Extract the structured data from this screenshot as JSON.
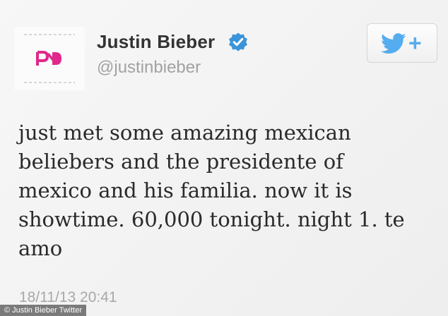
{
  "tweet": {
    "user": {
      "name": "Justin Bieber",
      "handle": "@justinbieber",
      "verified": true
    },
    "follow_button": {
      "icon": "twitter-bird-icon",
      "label": "+"
    },
    "text_lines": [
      "just met some amazing mexican",
      "beliebers and the presidente of",
      "mexico and his familia. now it is",
      "showtime. 60,000 tonight. night 1. te",
      "amo"
    ],
    "timestamp": "18/11/13 20:41"
  },
  "credit": "© Justin Bieber Twitter",
  "colors": {
    "twitter_blue": "#55acee",
    "verified_blue": "#3b94d9",
    "logo_magenta": "#e0288c"
  }
}
